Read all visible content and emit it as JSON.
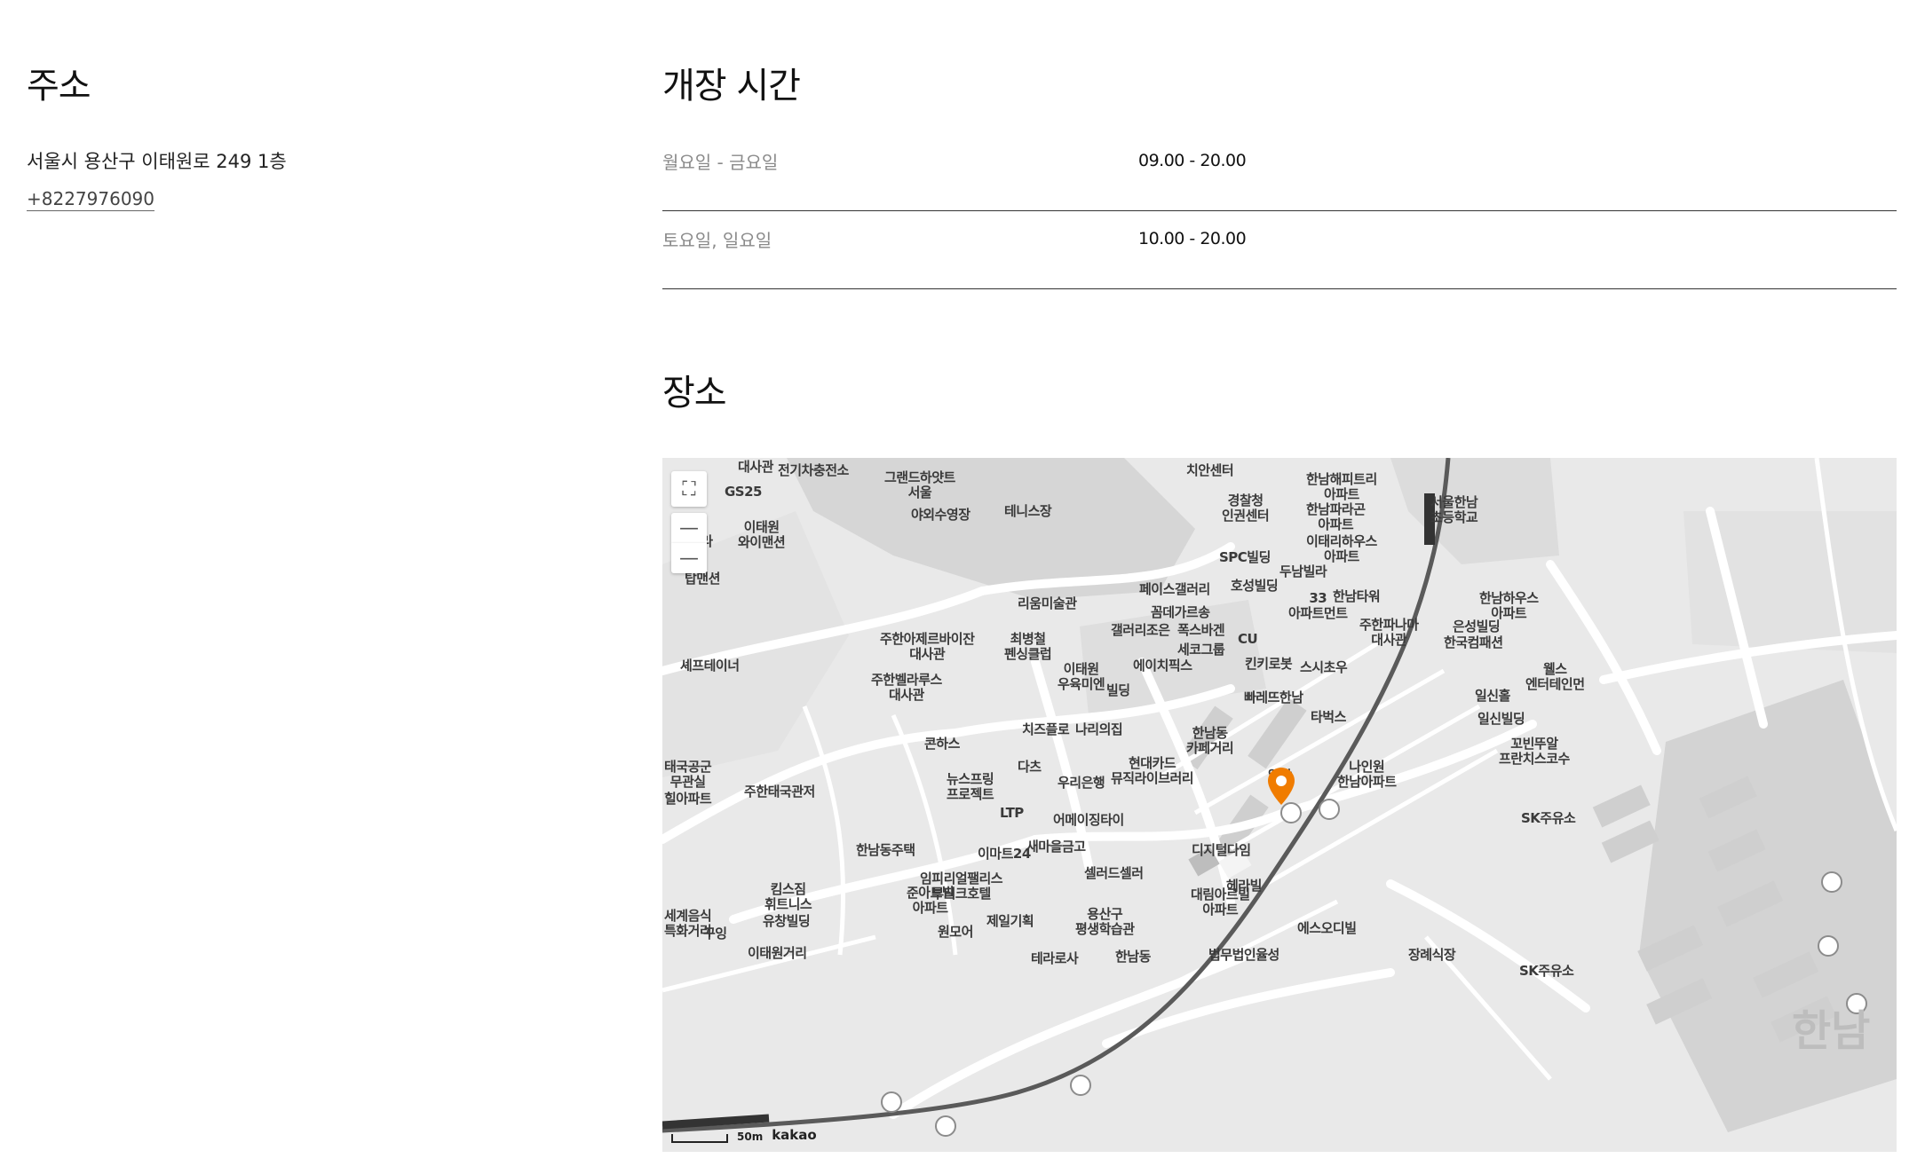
{
  "address": {
    "title": "주소",
    "line": "서울시 용산구 이태원로 249 1층",
    "phone": "+8227976090"
  },
  "hours": {
    "title": "개장 시간",
    "rows": [
      {
        "day": "월요일 - 금요일",
        "time": "09.00 - 20.00"
      },
      {
        "day": "토요일, 일요일",
        "time": "10.00 - 20.00"
      }
    ]
  },
  "place": {
    "title": "장소"
  },
  "map": {
    "marker_color": "#f07c00",
    "road_color": "#5a5a5a",
    "controls": [
      {
        "name": "fullscreen-icon",
        "glyph": "⛶"
      },
      {
        "name": "zoom-in-icon",
        "glyph": "—"
      },
      {
        "name": "zoom-out-icon",
        "glyph": "—"
      }
    ],
    "scale": "50m",
    "logo": "kakao",
    "area_label": "한남",
    "labels": [
      "대사관",
      "전기차충전소",
      "그랜드하얏트\n서울",
      "야외수영장",
      "테니스장",
      "GS25",
      "이태원\n와이맨션",
      "CJ",
      "빌라",
      "탑맨션",
      "리움미술관",
      "주한아제르바이잔\n대사관",
      "최병철\n펜싱클럽",
      "셰프테이너",
      "주한벨라루스\n대사관",
      "이태원\n우육미엔",
      "치즈플로",
      "나리의집",
      "콘하스",
      "다츠",
      "뉴스프링\n프로젝트",
      "우리은행",
      "LTP",
      "어메이징타이",
      "한남동주택",
      "이마트24",
      "새마을금고",
      "셀러드셀러",
      "임피리얼팰리스\n부티크호텔",
      "준아트빌\n아파트",
      "킴스짐\n휘트니스",
      "유창빌딩",
      "제일기획",
      "원모어",
      "용산구\n평생학습관",
      "한남동",
      "대림아르빌\n아파트",
      "헤라빌",
      "에스오디빌",
      "법무법인율성",
      "경찰청\n인권센터",
      "SPC빌딩",
      "호성빌딩",
      "두남빌라",
      "한남타워",
      "33\n아파트먼트",
      "주한파나마\n대사관",
      "한국컴패션",
      "은성빌딩",
      "한남해피트리\n아파트",
      "한남파라곤\n아파트",
      "이태리하우스\n아파트",
      "서울한남\n초등학교",
      "한남하우스\n아파트",
      "페이스갤러리",
      "꼼데가르송",
      "갤러리조은",
      "폭스바겐",
      "세코그룹",
      "CU",
      "에이치픽스",
      "킨키로봇",
      "스시초우",
      "빠레뜨한남",
      "타벅스",
      "한남동\n카페거리",
      "현대카드\n뮤직라이브러리",
      "알밤",
      "디지털다임",
      "나인원\n한남아파트",
      "일신홀",
      "일신빌딩",
      "꼬빈뚜알\n프란치스코수",
      "웰스\n엔터테인먼",
      "SK주유소",
      "SK주유소",
      "주한태국관저",
      "태국공군\n무관실",
      "힐아파트",
      "세계음식\n특화거리",
      "꾸잉",
      "이태원거리",
      "테라로사",
      "장례식장",
      "치안센터",
      "빌딩"
    ]
  }
}
